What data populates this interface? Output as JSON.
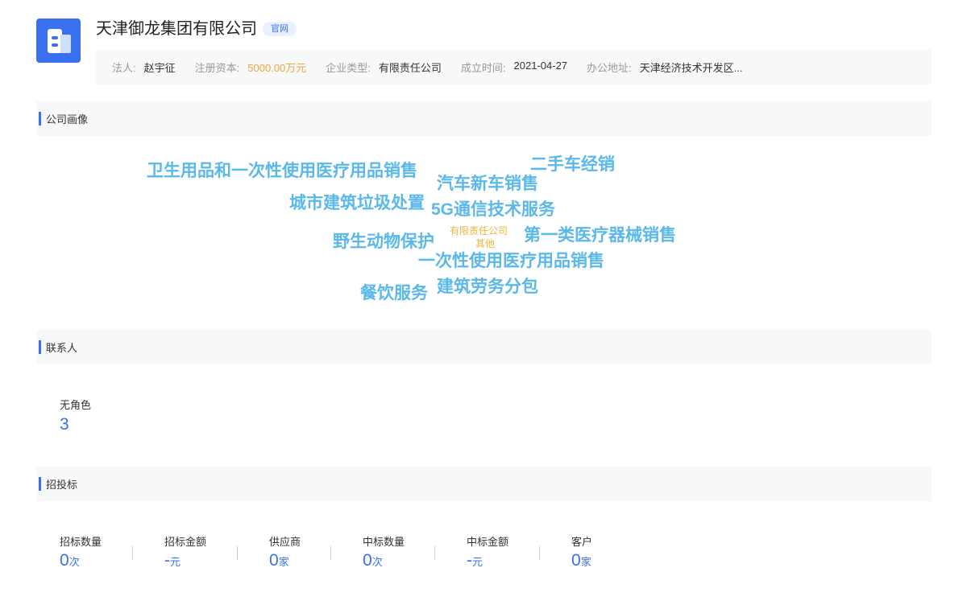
{
  "header": {
    "company_name": "天津御龙集团有限公司",
    "official_badge": "官网",
    "logo_icon": "building-logo-icon"
  },
  "info": [
    {
      "label": "法人:",
      "value": "赵宇征"
    },
    {
      "label": "注册资本:",
      "value": "5000.00万元"
    },
    {
      "label": "企业类型:",
      "value": "有限责任公司"
    },
    {
      "label": "成立时间:",
      "value": "2021-04-27"
    },
    {
      "label": "办公地址:",
      "value": "天津经济技术开发区..."
    }
  ],
  "colors": {
    "accent": "#3a6ff0",
    "cloud_word": "#5bb8ea",
    "cloud_small": "#f0b43c",
    "capital": "#f0a53c"
  },
  "portrait": {
    "title": "公司画像",
    "words": [
      "卫生用品和一次性使用医疗用品销售",
      "二手车经销",
      "汽车新车销售",
      "城市建筑垃圾处置",
      "5G通信技术服务",
      "野生动物保护",
      "有限责任公司",
      "其他",
      "第一类医疗器械销售",
      "一次性使用医疗用品销售",
      "餐饮服务",
      "建筑劳务分包"
    ]
  },
  "contacts": {
    "title": "联系人",
    "role_label": "无角色",
    "role_count": "3"
  },
  "bidding": {
    "title": "招投标",
    "stats": [
      {
        "label": "招标数量",
        "value": "0",
        "unit": "次"
      },
      {
        "label": "招标金额",
        "value": "-",
        "unit": "元"
      },
      {
        "label": "供应商",
        "value": "0",
        "unit": "家"
      },
      {
        "label": "中标数量",
        "value": "0",
        "unit": "次"
      },
      {
        "label": "中标金额",
        "value": "-",
        "unit": "元"
      },
      {
        "label": "客户",
        "value": "0",
        "unit": "家"
      }
    ]
  }
}
